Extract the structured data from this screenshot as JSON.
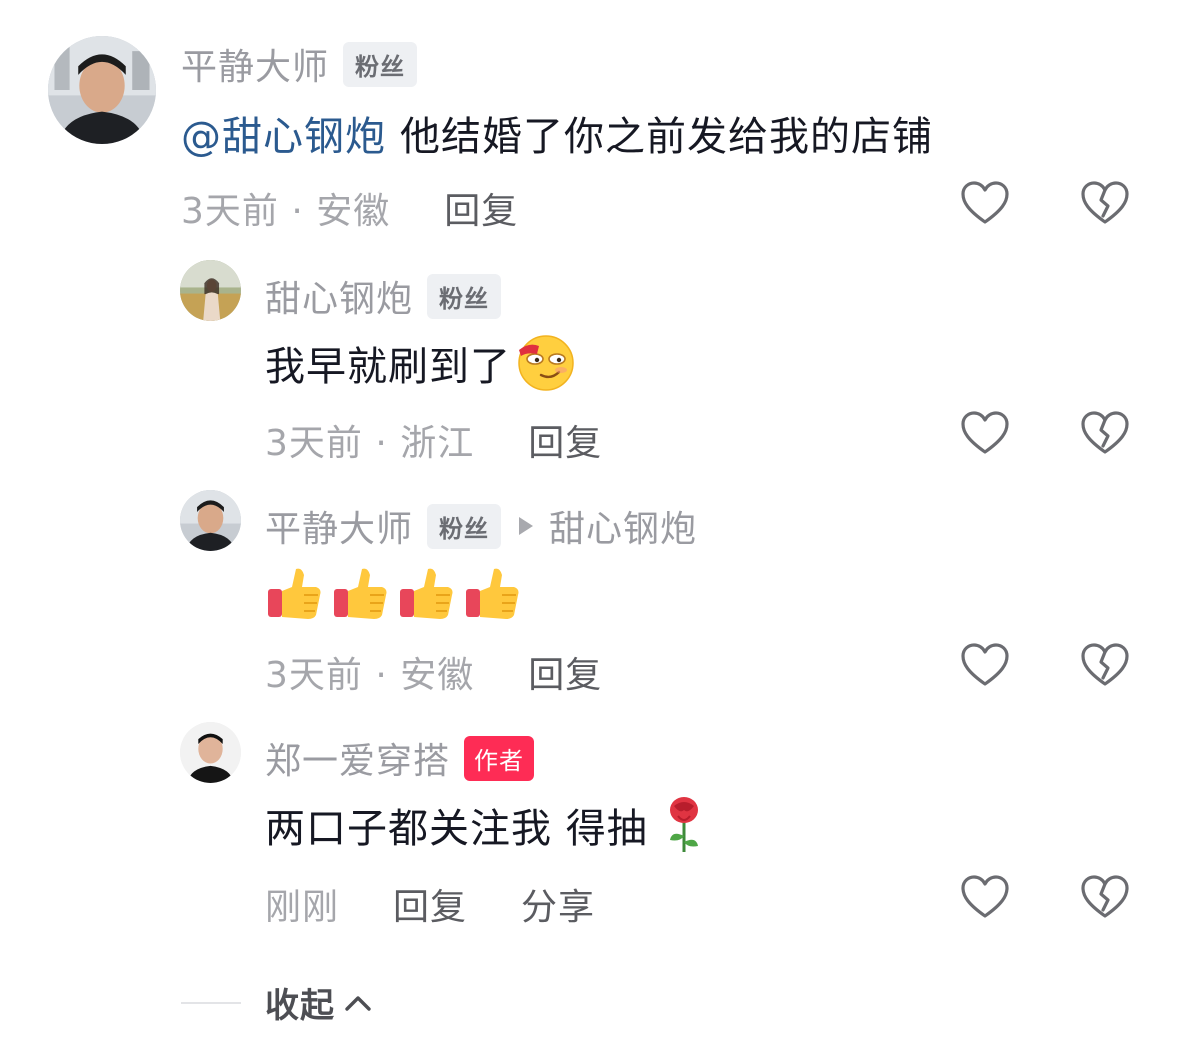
{
  "comments": [
    {
      "username": "平静大师",
      "badge": "粉丝",
      "mention": "@甜心钢炮",
      "text": "他结婚了你之前发给我的店铺",
      "time": "3天前 · 安徽",
      "reply_label": "回复"
    },
    {
      "username": "甜心钢炮",
      "badge": "粉丝",
      "text": "我早就刷到了",
      "emoji": "smirk-emoji",
      "time": "3天前 · 浙江",
      "reply_label": "回复"
    },
    {
      "username": "平静大师",
      "badge": "粉丝",
      "reply_to": "甜心钢炮",
      "emoji": "thumbs-up-emoji",
      "emoji_count": 4,
      "time": "3天前 · 安徽",
      "reply_label": "回复"
    },
    {
      "username": "郑一爱穿搭",
      "badge": "作者",
      "text": "两口子都关注我 得抽",
      "emoji": "rose-emoji",
      "time": "刚刚",
      "reply_label": "回复",
      "share_label": "分享"
    }
  ],
  "collapse_label": "收起",
  "colors": {
    "mention": "#2b5a8f",
    "author_badge": "#fe2c55",
    "muted_text": "#9a9ba1"
  },
  "icons": {
    "like": "heart-outline-icon",
    "dislike": "broken-heart-icon",
    "collapse": "chevron-up-icon"
  }
}
